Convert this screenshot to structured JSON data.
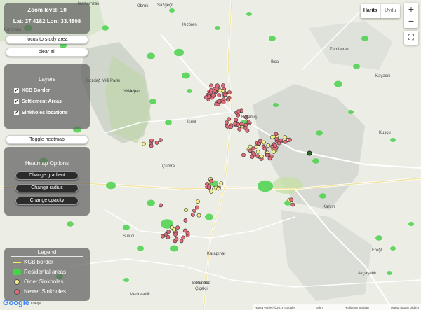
{
  "status": {
    "zoom_label": "Zoom level: 10",
    "lat_label": "Lat: 37.4182",
    "lon_label": "Lon: 33.4808"
  },
  "buttons": {
    "focus": "focus to study area",
    "clear": "clear all",
    "toggle_heatmap": "Toggle heatmap"
  },
  "layers": {
    "title": "Layers",
    "items": [
      {
        "label": "KCB Border",
        "checked": true
      },
      {
        "label": "Settlement Areas",
        "checked": true
      },
      {
        "label": "Sinkholes locations",
        "checked": true
      }
    ]
  },
  "heatmap": {
    "title": "Heatmap Options",
    "gradient": "Change gradient",
    "radius": "Change radius",
    "opacity": "Change opacity"
  },
  "legend": {
    "title": "Legend",
    "items": [
      {
        "label": "KCB border",
        "color": "#f2ee5a"
      },
      {
        "label": "Residental areas",
        "color": "#4ad14a"
      },
      {
        "label": "Older Sinkholes",
        "color": "#f2ee88"
      },
      {
        "label": "Newer Sinkholes",
        "color": "#e36a78"
      }
    ]
  },
  "map_type": {
    "map": "Harita",
    "satellite": "Uydu"
  },
  "zoom_controls": {
    "plus": "+",
    "minus": "−",
    "fullscreen": "⛶"
  },
  "attribution": {
    "logo": "Google",
    "keyboard": "Klavye",
    "data": "Harita verileri ©2019 Google",
    "scale": "5 km",
    "terms": "Kullanım Şartları",
    "report": "Harita hatası bildirin"
  },
  "places": [
    {
      "name": "Hacıhamzalı"
    },
    {
      "name": "Obruk"
    },
    {
      "name": "Kızören"
    },
    {
      "name": "Kızılyaka"
    },
    {
      "name": "Ilıca"
    },
    {
      "name": "Zemberek"
    },
    {
      "name": "Kayacık"
    },
    {
      "name": "Yavşan"
    },
    {
      "name": "Bozdağ Milli Parkı"
    },
    {
      "name": "Yıldızlı"
    },
    {
      "name": "İsmil"
    },
    {
      "name": "Hotamış"
    },
    {
      "name": "Çumra"
    },
    {
      "name": "Karkın"
    },
    {
      "name": "Kuşçu"
    },
    {
      "name": "Sulucu"
    },
    {
      "name": "Karapınar"
    },
    {
      "name": "Kızıller"
    },
    {
      "name": "Burunoba"
    },
    {
      "name": "Akçaşehir"
    },
    {
      "name": "Medreselik"
    },
    {
      "name": "Çiçekli"
    },
    {
      "name": "Ereğli"
    },
    {
      "name": "Sazgeçit"
    }
  ],
  "colors": {
    "newer_fill": "#e36a78",
    "older_fill": "#f2ee88",
    "residential": "#4ad14a",
    "border_line": "#f2ee5a"
  }
}
